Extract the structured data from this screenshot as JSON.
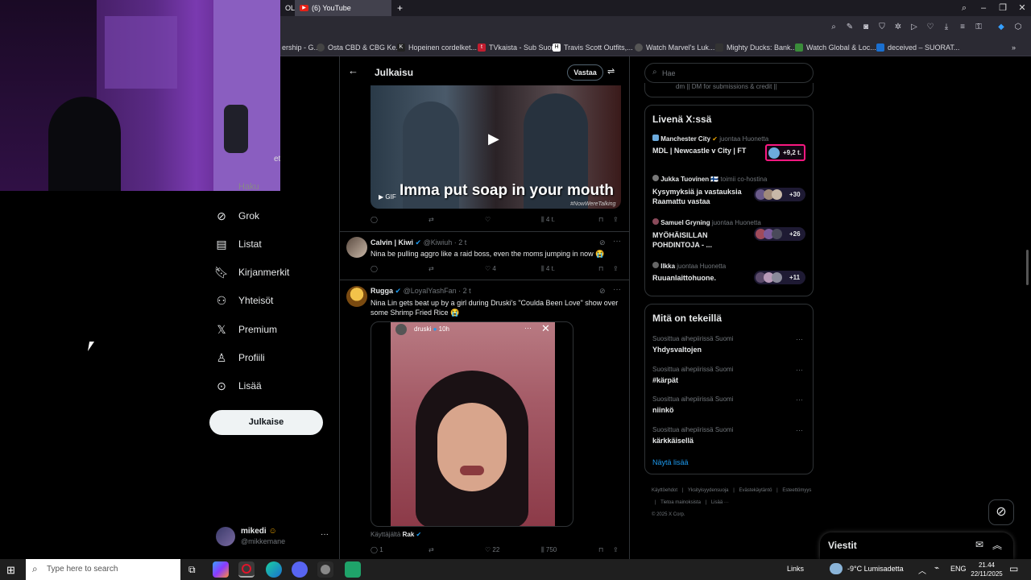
{
  "browser": {
    "tabs": [
      {
        "label": "OL"
      },
      {
        "label": "(6) YouTube",
        "active": true
      }
    ],
    "new_tab": "+",
    "bookmarks": [
      {
        "label": "ership - G..."
      },
      {
        "label": "Osta CBD & CBG Ke..."
      },
      {
        "label": "Hopeinen cordelket..."
      },
      {
        "label": "TVkaista - Sub Suora"
      },
      {
        "label": "Travis Scott Outfits,..."
      },
      {
        "label": "Watch Marvel's Luk..."
      },
      {
        "label": "Mighty Ducks: Bank..."
      },
      {
        "label": "Watch Global & Loc..."
      },
      {
        "label": "deceived – SUORAT..."
      }
    ]
  },
  "webcam": {
    "partial_text": "et"
  },
  "sidebar": {
    "partial_item": "Haku",
    "items": [
      {
        "icon": "grok-icon",
        "label": "Grok"
      },
      {
        "icon": "list-icon",
        "label": "Listat"
      },
      {
        "icon": "bookmark-icon",
        "label": "Kirjanmerkit"
      },
      {
        "icon": "communities-icon",
        "label": "Yhteisöt"
      },
      {
        "icon": "x-logo-icon",
        "label": "Premium"
      },
      {
        "icon": "profile-icon",
        "label": "Profiili"
      },
      {
        "icon": "more-icon",
        "label": "Lisää"
      }
    ],
    "post_button": "Julkaise",
    "account": {
      "name": "mikedi",
      "handle": "@mikkemane"
    }
  },
  "post_view": {
    "title": "Julkaisu",
    "reply_button": "Vastaa",
    "gif_caption": "Imma put soap in your mouth",
    "gif_badge": "GIF",
    "gif_watermark": "#NowWereTalking",
    "first_actions": {
      "views": "4 t."
    },
    "replies": [
      {
        "name": "Calvin | Kiwi",
        "handle": "@Kiwiuh",
        "time": "2 t",
        "text": "Nina be pulling aggro like a raid boss, even the moms jumping in now 😭",
        "likes": "4",
        "views": "4 t."
      },
      {
        "name": "Rugga",
        "handle": "@LoyalYashFan",
        "time": "2 t",
        "text": "Nina Lin gets beat up by a girl during Druski's \"Coulda Been Love\" show over some Shrimp Fried Rice 😭",
        "embed_user": "druski",
        "embed_time": "10h",
        "used_by_prefix": "Käyttäjältä",
        "used_by": "Rak",
        "replies_count": "1",
        "likes": "22",
        "views": "750"
      }
    ]
  },
  "right": {
    "search_placeholder": "Hae",
    "partial_text": "dm || DM for submissions & credit ||",
    "live": {
      "title": "Livenä X:ssä",
      "items": [
        {
          "host": "Manchester City",
          "role": "juontaa Huonetta",
          "title": "MDL | Newcastle v City | FT",
          "count": "+9,2 t."
        },
        {
          "host": "Jukka Tuovinen 🇫🇮",
          "role": "toimii co-hostina",
          "title": "Kysymyksiä ja vastauksia Raamattu vastaa",
          "count": "+30"
        },
        {
          "host": "Samuel Gryning",
          "role": "juontaa Huonetta",
          "title": "MYÖHÄISILLAN POHDINTOJA - ...",
          "count": "+26"
        },
        {
          "host": "Ilkka",
          "role": "juontaa Huonetta",
          "title": "Ruuanlaittohuone.",
          "count": "+11"
        }
      ]
    },
    "trends": {
      "title": "Mitä on tekeillä",
      "items": [
        {
          "context": "Suosittua aihepiirissä Suomi",
          "name": "Yhdysvaltojen"
        },
        {
          "context": "Suosittua aihepiirissä Suomi",
          "name": "#kärpät"
        },
        {
          "context": "Suosittua aihepiirissä Suomi",
          "name": "niinkö"
        },
        {
          "context": "Suosittua aihepiirissä Suomi",
          "name": "kärkkäisellä"
        }
      ],
      "show_more": "Näytä lisää"
    },
    "footer": [
      "Käyttöehdot",
      "Yksityisyydensuoja",
      "Evästekäytäntö",
      "Esteettömyys",
      "Tietoa mainoksista",
      "Lisää ···",
      "© 2025 X Corp."
    ],
    "messages_title": "Viestit"
  },
  "taskbar": {
    "search_placeholder": "Type here to search",
    "links_label": "Links",
    "weather": "-9°C  Lumisadetta",
    "language": "ENG",
    "time": "21.44",
    "date": "22/11/2025"
  }
}
